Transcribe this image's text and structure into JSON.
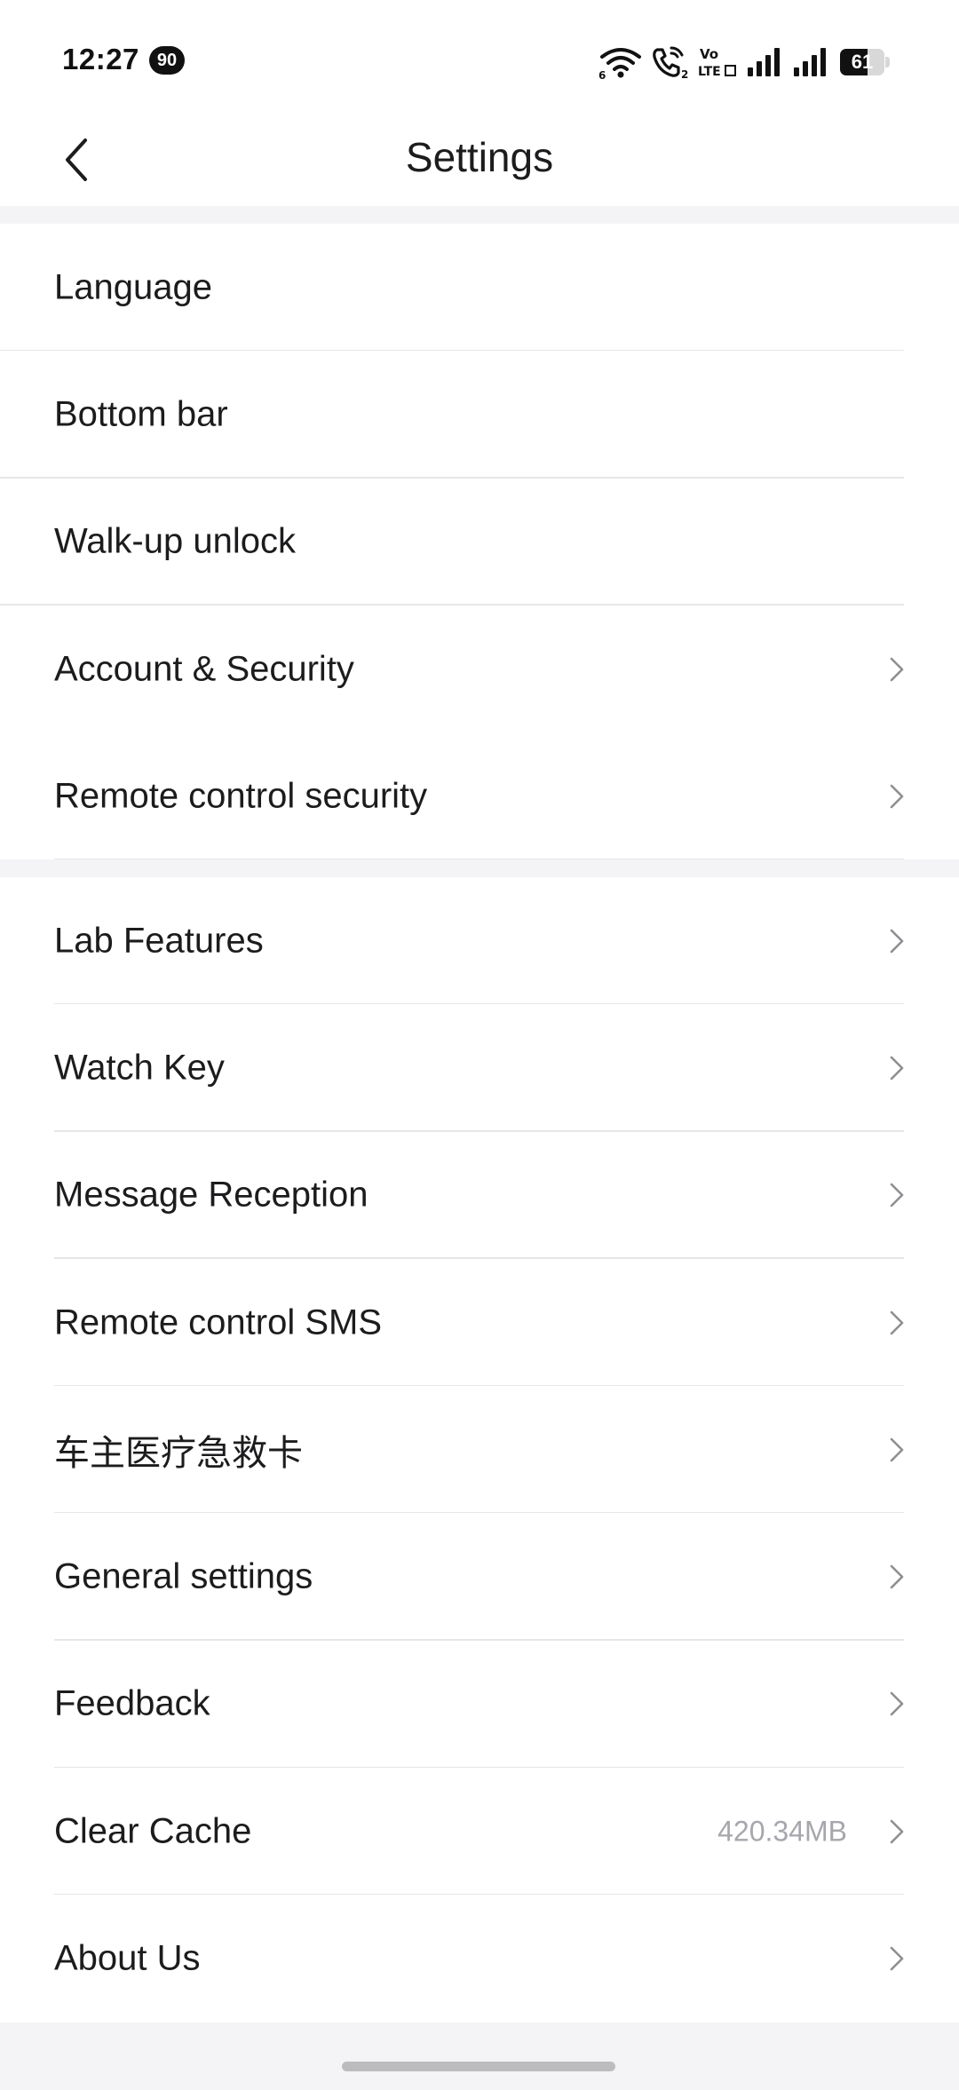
{
  "status_bar": {
    "time": "12:27",
    "notification_badge": "90",
    "battery_percent": 61,
    "battery_label": "61",
    "icons": [
      "wifi-6-icon",
      "wifi-call-icon",
      "volte-icon",
      "signal-1-icon",
      "signal-2-icon",
      "battery-icon"
    ]
  },
  "header": {
    "title": "Settings",
    "back_icon": "chevron-left-icon"
  },
  "groups": [
    {
      "items": [
        {
          "label": "Language",
          "chevron": false
        },
        {
          "label": "Bottom bar",
          "chevron": false
        },
        {
          "label": "Walk-up unlock",
          "chevron": false
        },
        {
          "label": "Account & Security",
          "chevron": true
        },
        {
          "label": "Remote control security",
          "chevron": true
        }
      ]
    },
    {
      "items": [
        {
          "label": "Lab Features",
          "chevron": true
        },
        {
          "label": "Watch Key",
          "chevron": true
        },
        {
          "label": "Message Reception",
          "chevron": true
        },
        {
          "label": "Remote control SMS",
          "chevron": true
        },
        {
          "label": "车主医疗急救卡",
          "chevron": true
        },
        {
          "label": "General settings",
          "chevron": true
        },
        {
          "label": "Feedback",
          "chevron": true
        },
        {
          "label": "Clear Cache",
          "value": "420.34MB",
          "chevron": true
        },
        {
          "label": "About Us",
          "chevron": true
        }
      ]
    }
  ],
  "colors": {
    "page_background": "#f4f4f6",
    "card_background": "#ffffff",
    "text_primary": "#1c1c1e",
    "text_secondary": "#a6a6ad",
    "chevron": "#8e8e93",
    "divider": "#e6e6ea"
  }
}
